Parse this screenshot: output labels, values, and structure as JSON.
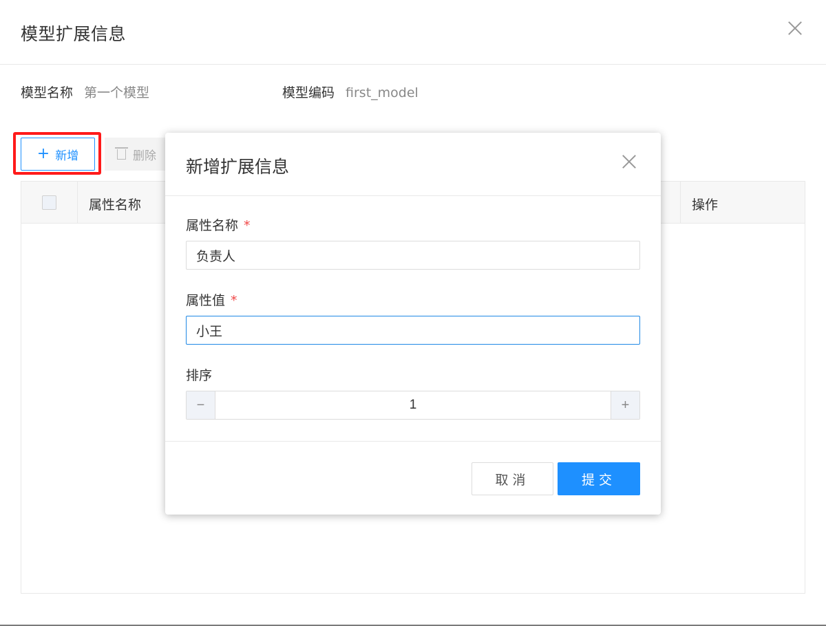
{
  "outer_dialog": {
    "title": "模型扩展信息",
    "model_name_label": "模型名称",
    "model_name_value": "第一个模型",
    "model_code_label": "模型编码",
    "model_code_value": "first_model"
  },
  "toolbar": {
    "add_label": "新增",
    "delete_label": "删除"
  },
  "table": {
    "columns": [
      "属性名称",
      "操作"
    ]
  },
  "modal": {
    "title": "新增扩展信息",
    "fields": [
      {
        "label": "属性名称",
        "required_mark": "*",
        "value": "负责人"
      },
      {
        "label": "属性值",
        "required_mark": "*",
        "value": "小王"
      },
      {
        "label": "排序",
        "value": "1"
      }
    ],
    "stepper_minus": "−",
    "stepper_plus": "+",
    "cancel_label": "取消",
    "submit_label": "提交"
  },
  "colors": {
    "primary": "#1e90ff",
    "highlight": "#ff1a1a",
    "required": "#f04848"
  }
}
